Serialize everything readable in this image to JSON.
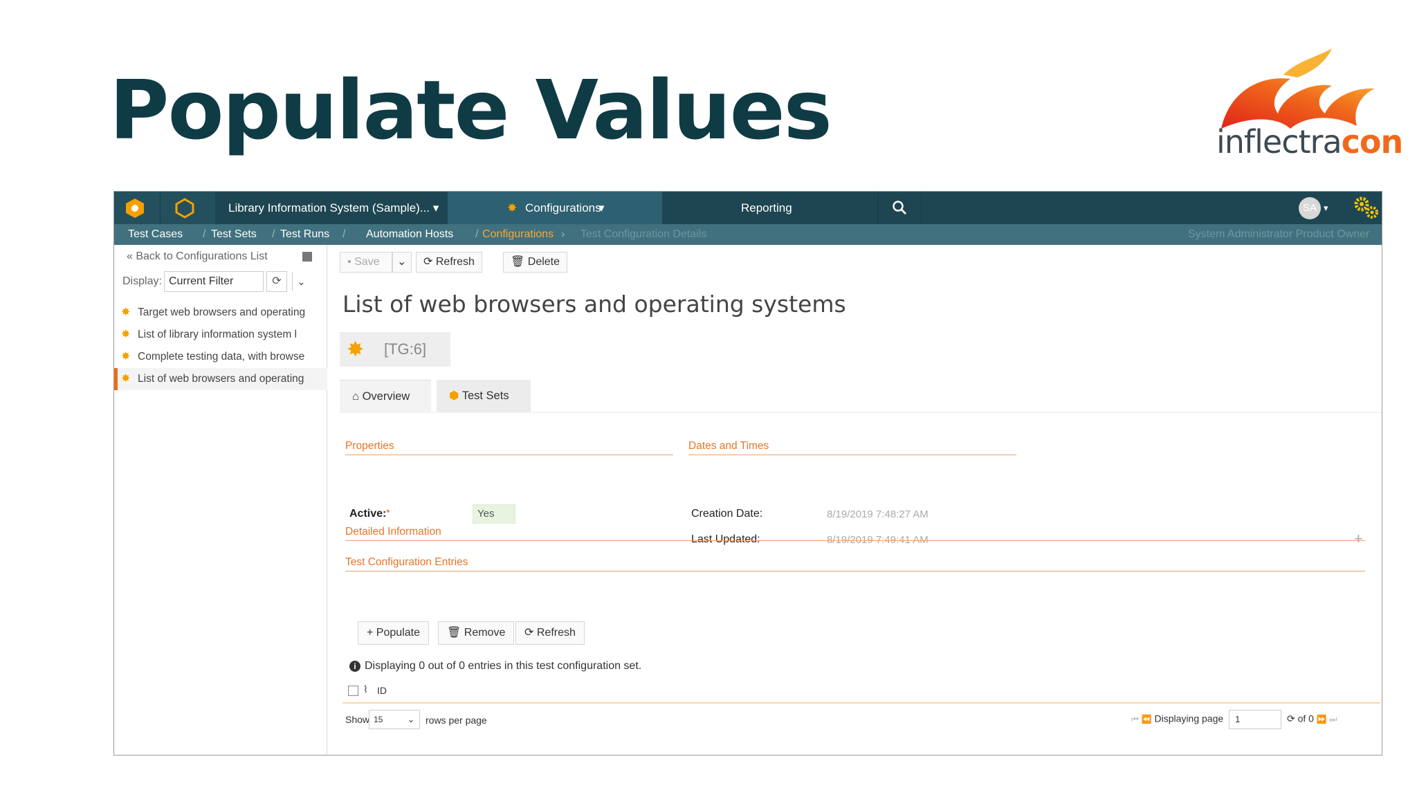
{
  "slide": {
    "title": "Populate Values",
    "logo_text_a": "inflectra",
    "logo_text_b": "con"
  },
  "topnav": {
    "project": "Library Information System (Sample)...",
    "configurations": "Configurations",
    "reporting": "Reporting",
    "avatar": "SA",
    "caret": "▾"
  },
  "subnav": {
    "items": [
      "Test Cases",
      "Test Sets",
      "Test Runs",
      "Automation Hosts",
      "Configurations",
      "Test Configuration Details"
    ],
    "separator": "/",
    "right": "System Administrator  Product Owner"
  },
  "sidebar": {
    "back": "Back to Configurations List",
    "display_label": "Display:",
    "filter_value": "Current Filter",
    "items": [
      "Target web browsers and operating",
      "List of library information system l",
      "Complete testing data, with browse",
      "List of web browsers and operating"
    ]
  },
  "toolbar": {
    "save": "Save",
    "refresh": "Refresh",
    "delete": "Delete"
  },
  "record": {
    "title": "List of web browsers and operating systems",
    "tag": "[TG:6]"
  },
  "tabs": {
    "overview": "Overview",
    "test_sets": "Test Sets"
  },
  "properties": {
    "section": "Properties",
    "active_label": "Active:",
    "active_value": "Yes"
  },
  "dates": {
    "section": "Dates and Times",
    "creation_label": "Creation Date:",
    "creation_value": "8/19/2019 7:48:27 AM",
    "updated_label": "Last Updated:",
    "updated_value": "8/19/2019 7:49:41 AM"
  },
  "detailed": {
    "section": "Detailed Information"
  },
  "entries": {
    "section": "Test Configuration Entries",
    "populate": "Populate",
    "remove": "Remove",
    "refresh": "Refresh",
    "info": "Displaying 0 out of 0 entries in this test configuration set.",
    "id_label": "ID"
  },
  "pager": {
    "show": "Show",
    "rows_value": "15",
    "rows_per_page": "rows per page",
    "displaying_page": "Displaying page",
    "page_value": "1",
    "of": "of 0"
  },
  "colors": {
    "nav_bg": "#1e4652",
    "subnav_bg": "#41717e",
    "accent": "#f06a1b",
    "title": "#0f3b45"
  }
}
